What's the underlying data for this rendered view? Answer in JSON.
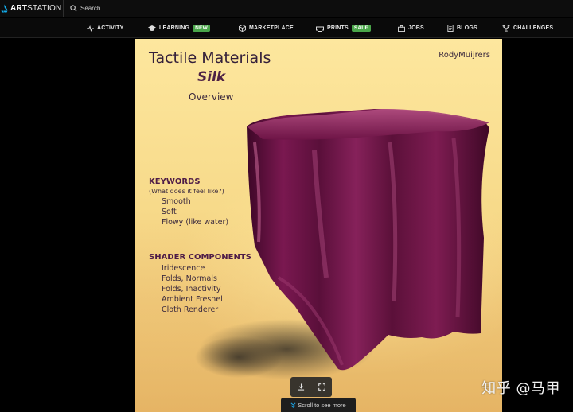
{
  "topbar": {
    "logo_bold": "ART",
    "logo_light": "STATION",
    "search_placeholder": "Search"
  },
  "nav": {
    "activity": "ACTIVITY",
    "learning": "LEARNING",
    "learning_badge": "NEW",
    "marketplace": "MARKETPLACE",
    "prints": "PRINTS",
    "prints_badge": "SALE",
    "jobs": "JOBS",
    "blogs": "BLOGS",
    "challenges": "CHALLENGES"
  },
  "colors": {
    "badge_green": "#4aa64a",
    "accent_blue": "#13aff0",
    "silk": "#6e1446"
  },
  "artwork": {
    "title": "Tactile Materials",
    "subtitle": "Silk",
    "overview": "Overview",
    "author": "RodyMuijrers",
    "keywords_heading": "KEYWORDS",
    "keywords_note": "(What does it feel like?)",
    "keywords": [
      "Smooth",
      "Soft",
      "Flowy (like water)"
    ],
    "shader_heading": "SHADER COMPONENTS",
    "shader_components": [
      "Iridescence",
      "Folds, Normals",
      "Folds, Inactivity",
      "Ambient Fresnel",
      "Cloth Renderer"
    ]
  },
  "viewer": {
    "download_icon": "download-icon",
    "fullscreen_icon": "fullscreen-icon",
    "scroll_hint": "Scroll to see more"
  },
  "watermark": "知乎 @马甲"
}
